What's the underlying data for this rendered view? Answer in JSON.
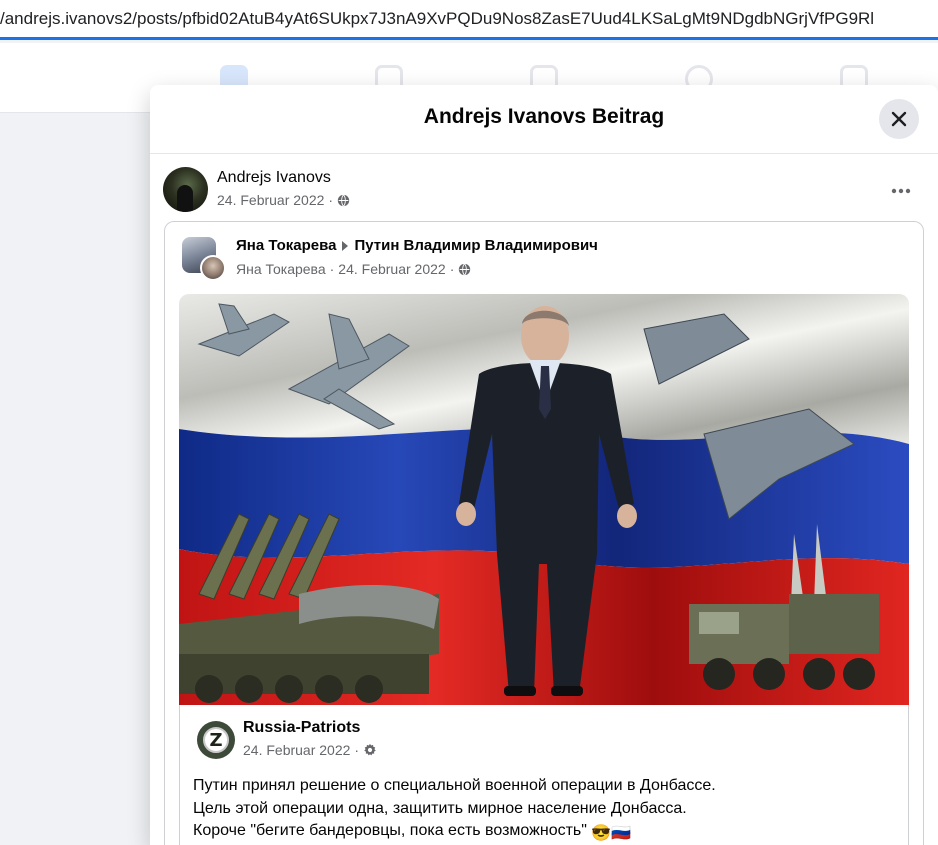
{
  "browser": {
    "url": "/andrejs.ivanovs2/posts/pfbid02AtuB4yAt6SUkpx7J3nA9XvPQDu9Nos8ZasE7Uud4LKSaLgMt9NDgdbNGrjVfPG9Rl"
  },
  "nav": {
    "icons": [
      "home-icon",
      "video-icon",
      "marketplace-icon",
      "groups-icon",
      "gaming-icon"
    ]
  },
  "modal": {
    "title": "Andrejs Ivanovs Beitrag",
    "close_icon": "close-icon"
  },
  "post": {
    "author": "Andrejs Ivanovs",
    "date": "24. Februar 2022",
    "separator": "·",
    "privacy_icon": "globe-icon",
    "more_icon": "more-horizontal-icon"
  },
  "shared_post": {
    "author": "Яна Токарева",
    "target": "Путин Владимир Владимирович",
    "meta_author": "Яна Токарева",
    "date": "24. Februar 2022",
    "separator": "·",
    "privacy_icon": "globe-icon",
    "image_icon": "russian-flag-military-image"
  },
  "original_post": {
    "page_name": "Russia-Patriots",
    "avatar_letter": "Z",
    "date": "24. Februar 2022",
    "separator": "·",
    "privacy_icon": "gear-icon",
    "lines": [
      "Путин принял решение о специальной военной операции в Донбассе.",
      "Цель этой операции одна, защитить мирное население Донбасса.",
      "Короче \"бегите бандеровцы, пока есть возможность\""
    ],
    "emojis": [
      "😎",
      "🇷🇺"
    ]
  },
  "colors": {
    "accent": "#1a73e8",
    "text": "#050505",
    "muted": "#65676b",
    "flag_white": "#f2f2f2",
    "flag_blue": "#1f3b9e",
    "flag_red": "#d21a1a"
  }
}
